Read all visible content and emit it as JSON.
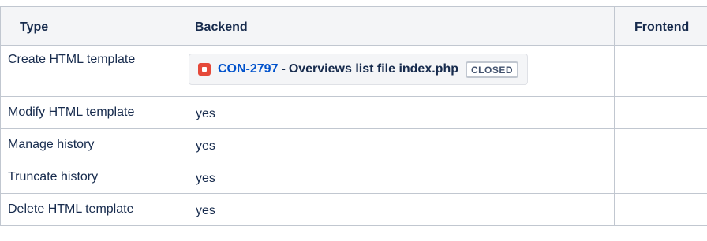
{
  "table": {
    "headers": {
      "type": "Type",
      "backend": "Backend",
      "frontend": "Frontend"
    },
    "rows": [
      {
        "type": "Create HTML template",
        "backend_issue": {
          "icon": "bug-issue-icon",
          "key": "CON-2797",
          "separator": "-",
          "summary": "Overviews list file index.php",
          "status": "CLOSED"
        },
        "frontend": ""
      },
      {
        "type": "Modify HTML template",
        "backend": "yes",
        "frontend": ""
      },
      {
        "type": "Manage history",
        "backend": "yes",
        "frontend": ""
      },
      {
        "type": "Truncate history",
        "backend": "yes",
        "frontend": ""
      },
      {
        "type": "Delete HTML template",
        "backend": "yes",
        "frontend": ""
      }
    ]
  },
  "colors": {
    "header_bg": "#f4f5f7",
    "border": "#c1c7d0",
    "link": "#0052cc",
    "bug_icon": "#e5493a",
    "text": "#172b4d"
  }
}
